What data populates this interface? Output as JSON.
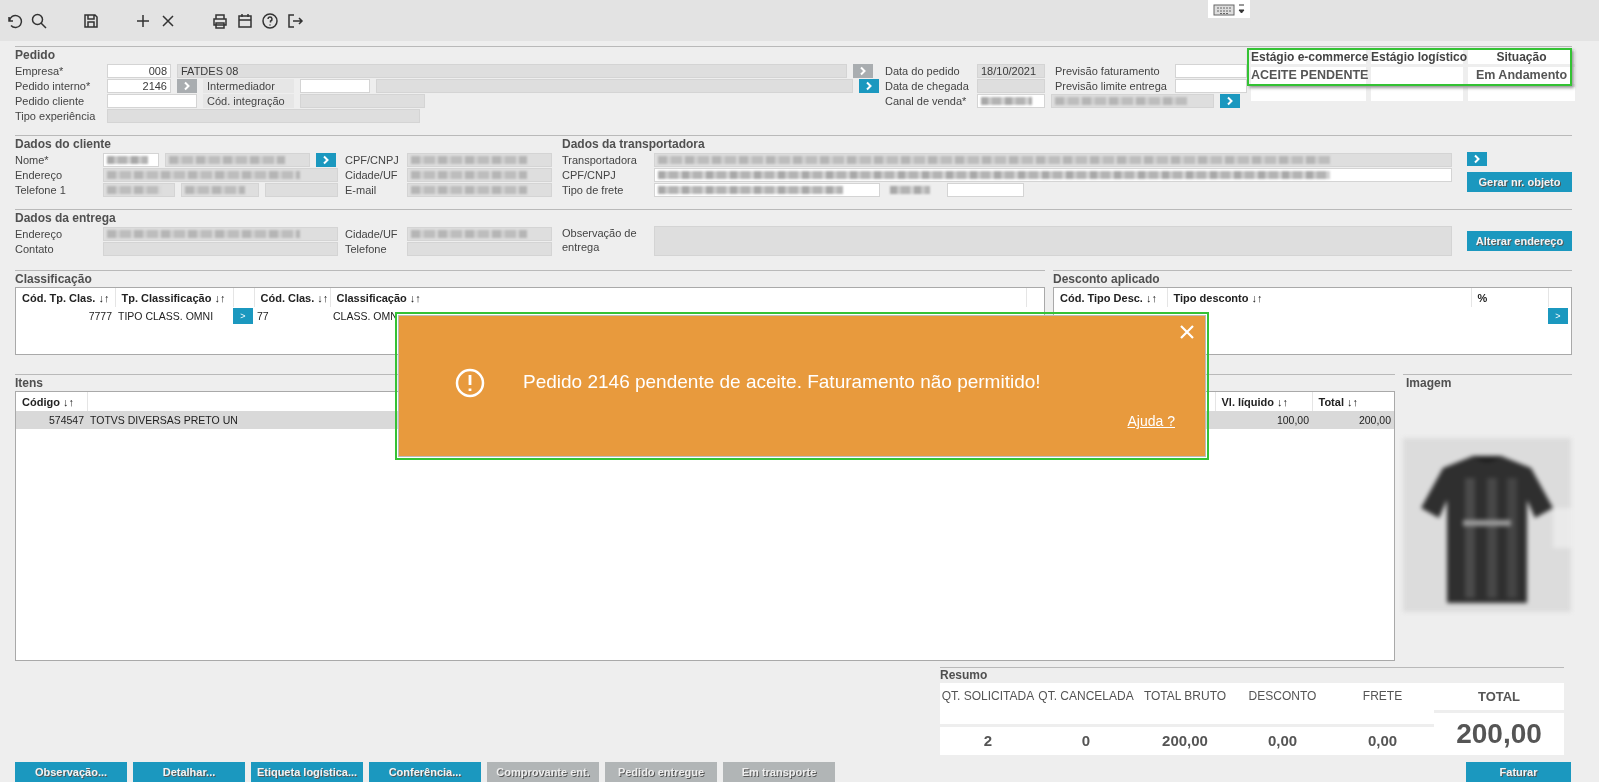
{
  "pedido": {
    "title": "Pedido",
    "left": [
      {
        "label": "Empresa*",
        "fields": [
          {
            "kind": "input",
            "value": "008"
          },
          {
            "kind": "readonly",
            "value": "FATDES 08"
          }
        ],
        "lookup": {
          "disabled": true
        }
      },
      {
        "label": "Pedido interno*",
        "fields": [
          {
            "kind": "input",
            "value": "2146"
          }
        ],
        "lookup": {
          "disabled": true
        },
        "sub": {
          "label": "Intermediador",
          "fields": [
            {
              "kind": "input"
            },
            {
              "kind": "readonly"
            }
          ],
          "lookup": {
            "disabled": false
          }
        }
      },
      {
        "label": "Pedido cliente",
        "fields": [
          {
            "kind": "input"
          }
        ],
        "sub": {
          "label": "Cód. integração",
          "fields": [
            {
              "kind": "readonly"
            }
          ]
        }
      },
      {
        "label": "Tipo experiência",
        "fields": [
          {
            "kind": "readonly"
          }
        ]
      }
    ],
    "mid": [
      {
        "label": "Data do pedido",
        "fields": [
          {
            "kind": "readonly",
            "value": "18/10/2021"
          }
        ],
        "sub": {
          "label": "Previsão faturamento",
          "fields": [
            {
              "kind": "input"
            }
          ]
        }
      },
      {
        "label": "Data de chegada",
        "fields": [
          {
            "kind": "readonly"
          }
        ],
        "sub": {
          "label": "Previsão limite entrega",
          "fields": [
            {
              "kind": "input"
            }
          ]
        }
      },
      {
        "label": "Canal de venda*",
        "fields": [
          {
            "kind": "input",
            "masked": true
          },
          {
            "kind": "readonly",
            "masked": true
          }
        ],
        "lookup": {
          "disabled": false
        }
      }
    ]
  },
  "stages": [
    {
      "header": "Estágio e-commerce",
      "value": "ACEITE PENDENTE"
    },
    {
      "header": "Estágio logístico"
    },
    {
      "header": "Situação",
      "value": "Em Andamento"
    }
  ],
  "cliente": {
    "title": "Dados do cliente",
    "left": [
      {
        "label": "Nome*",
        "fields": [
          {
            "kind": "input",
            "masked": true
          },
          {
            "kind": "readonly",
            "masked": true
          }
        ],
        "lookup": {
          "disabled": false
        }
      },
      {
        "label": "Endereço",
        "fields": [
          {
            "kind": "readonly",
            "masked": true
          }
        ]
      },
      {
        "label": "Telefone 1",
        "fields": [
          {
            "kind": "readonly",
            "masked": true
          },
          {
            "kind": "readonly",
            "masked": true
          },
          {
            "kind": "readonly"
          }
        ]
      }
    ],
    "right": [
      {
        "label": "CPF/CNPJ",
        "fields": [
          {
            "kind": "readonly",
            "masked": true
          }
        ]
      },
      {
        "label": "Cidade/UF",
        "fields": [
          {
            "kind": "readonly",
            "masked": true
          }
        ]
      },
      {
        "label": "E-mail",
        "fields": [
          {
            "kind": "readonly",
            "masked": true
          }
        ]
      }
    ]
  },
  "transportadora": {
    "title": "Dados da transportadora",
    "rows": [
      {
        "label": "Transportadora",
        "fields": [
          {
            "kind": "readonly",
            "masked": true
          }
        ]
      },
      {
        "label": "CPF/CNPJ",
        "fields": [
          {
            "kind": "input",
            "masked": true
          }
        ]
      },
      {
        "label": "Tipo de frete",
        "fields": [
          {
            "kind": "input",
            "masked": true
          },
          {
            "kind": "plain",
            "masked": true
          },
          {
            "kind": "input"
          }
        ]
      }
    ],
    "lookup": {
      "disabled": false
    },
    "action": {
      "label": "Gerar nr. objeto",
      "disabled": false
    }
  },
  "entrega": {
    "title": "Dados da entrega",
    "left": [
      {
        "label": "Endereço",
        "fields": [
          {
            "kind": "readonly",
            "masked": true
          }
        ]
      },
      {
        "label": "Contato",
        "fields": [
          {
            "kind": "readonly"
          }
        ]
      }
    ],
    "right": [
      {
        "label": "Cidade/UF",
        "fields": [
          {
            "kind": "readonly",
            "masked": true
          }
        ]
      },
      {
        "label": "Telefone",
        "fields": [
          {
            "kind": "readonly"
          }
        ]
      }
    ],
    "observacao": {
      "label": "Observação de entrega",
      "field": {
        "kind": "readonly"
      }
    },
    "action": {
      "label": "Alterar endereço",
      "disabled": false
    }
  },
  "classificacao": {
    "title": "Classificação",
    "columns": [
      {
        "kind": "number",
        "header": "Cód. Tp. Clas. ↓↑"
      },
      {
        "kind": "text",
        "header": "Tp. Classificação ↓↑"
      },
      {
        "kind": "button"
      },
      {
        "kind": "text",
        "header": "Cód. Clas. ↓↑"
      },
      {
        "kind": "text",
        "header": "Classificação ↓↑"
      }
    ],
    "rows": [
      {
        "selected": false,
        "cells": [
          "7777",
          "TIPO CLASS. OMNI",
          ">",
          "77",
          "CLASS. OMN"
        ]
      }
    ]
  },
  "desconto": {
    "title": "Desconto aplicado",
    "columns": [
      {
        "kind": "text",
        "header": "Cód. Tipo Desc. ↓↑"
      },
      {
        "kind": "text",
        "header": "Tipo desconto ↓↑"
      },
      {
        "kind": "text",
        "header": "%"
      }
    ],
    "action": ">"
  },
  "itens": {
    "title": "Itens",
    "columns": [
      {
        "kind": "number",
        "header": "Código ↓↑"
      },
      {
        "kind": "text"
      },
      {
        "kind": "number",
        "header": "Vl. líquido ↓↑"
      },
      {
        "kind": "number",
        "header": "Total ↓↑"
      }
    ],
    "rows": [
      {
        "selected": true,
        "cells": [
          "574547",
          "TOTVS DIVERSAS PRETO UN",
          "100,00",
          "200,00"
        ]
      }
    ]
  },
  "imagem": {
    "title": "Imagem"
  },
  "resumo": {
    "title": "Resumo",
    "columns": [
      {
        "header": "QT. SOLICITADA",
        "value": "2"
      },
      {
        "header": "QT. CANCELADA",
        "value": "0"
      },
      {
        "header": "TOTAL BRUTO",
        "value": "200,00"
      },
      {
        "header": "DESCONTO",
        "value": "0,00"
      },
      {
        "header": "FRETE",
        "value": "0,00"
      }
    ],
    "total": {
      "header": "TOTAL",
      "value": "200,00"
    }
  },
  "buttons": [
    {
      "label": "Observação...",
      "disabled": false
    },
    {
      "label": "Detalhar...",
      "disabled": false
    },
    {
      "label": "Etiqueta logística...",
      "disabled": false
    },
    {
      "label": "Conferência...",
      "disabled": false
    },
    {
      "label": "Comprovante ent.",
      "disabled": true
    },
    {
      "label": "Pedido entregue",
      "disabled": true
    },
    {
      "label": "Em transporte",
      "disabled": true
    }
  ],
  "faturar": {
    "label": "Faturar",
    "disabled": false
  },
  "toast": {
    "message": "Pedido 2146 pendente de aceite. Faturamento não permitido!",
    "link": "Ajuda ?"
  }
}
